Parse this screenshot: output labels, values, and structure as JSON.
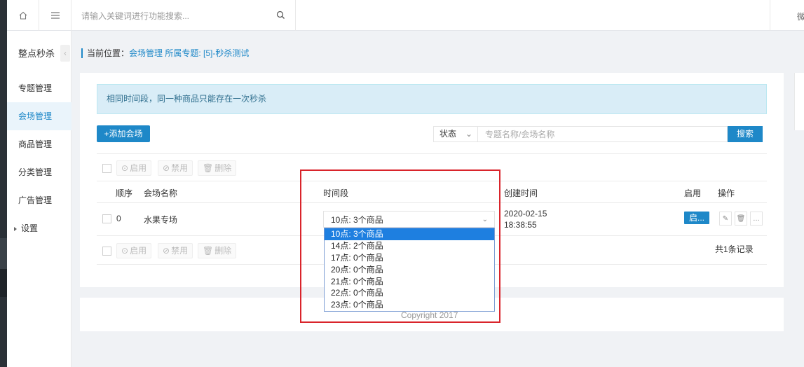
{
  "topbar": {
    "search_placeholder": "请输入关键词进行功能搜索...",
    "right_text": "微"
  },
  "sidebar": {
    "title": "整点秒杀",
    "items": [
      {
        "label": "专题管理",
        "active": false
      },
      {
        "label": "会场管理",
        "active": true
      },
      {
        "label": "商品管理",
        "active": false
      },
      {
        "label": "分类管理",
        "active": false
      },
      {
        "label": "广告管理",
        "active": false
      },
      {
        "label": "设置",
        "active": false
      }
    ]
  },
  "breadcrumb": {
    "prefix": "当前位置：",
    "link": "会场管理 所属专题: [5]-秒杀测试"
  },
  "notice": "相同时间段，同一种商品只能存在一次秒杀",
  "toolbar": {
    "add_label": "+添加会场",
    "status_label": "状态",
    "keyword_placeholder": "专题名称/会场名称",
    "search_label": "搜索"
  },
  "bulk": {
    "enable": "启用",
    "disable": "禁用",
    "delete": "删除"
  },
  "table": {
    "headers": {
      "order": "顺序",
      "name": "会场名称",
      "time": "时间段",
      "created": "创建时间",
      "enabled": "启用",
      "ops": "操作"
    },
    "rows": [
      {
        "order": "0",
        "name": "水果专场",
        "time": "10点: 3个商品",
        "created_date": "2020-02-15",
        "created_time": "18:38:55",
        "enabled_label": "启..."
      }
    ],
    "total": "共1条记录"
  },
  "time_options": [
    "10点: 3个商品",
    "14点: 2个商品",
    "17点: 0个商品",
    "20点: 0个商品",
    "21点: 0个商品",
    "22点: 0个商品",
    "23点: 0个商品"
  ],
  "footer": "Copyright 2017",
  "colors": {
    "accent": "#1e88c8",
    "highlight": "#d9242b",
    "selected_option": "#1e7fe0"
  }
}
